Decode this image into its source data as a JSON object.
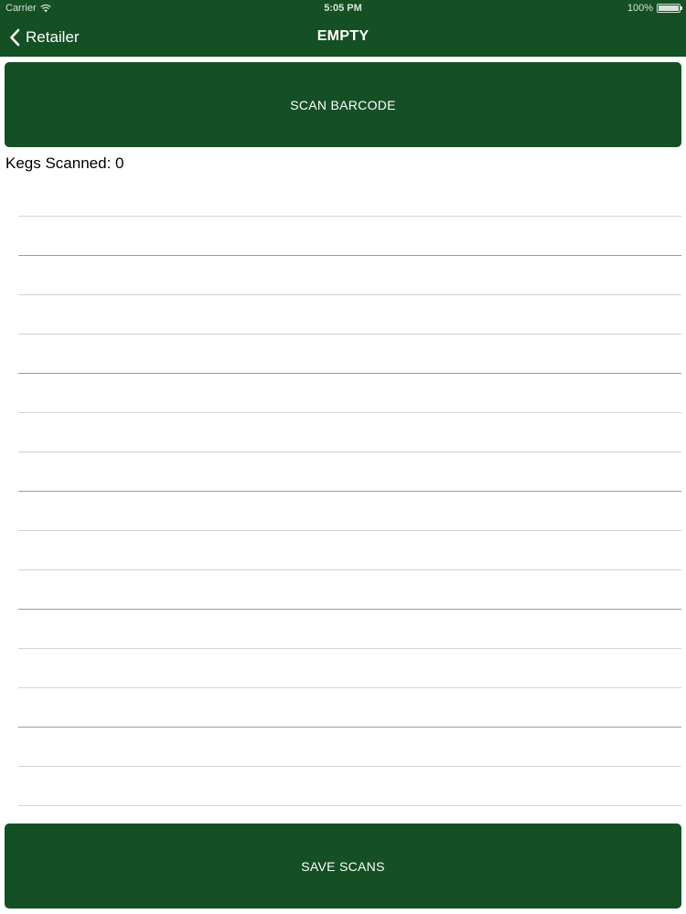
{
  "status_bar": {
    "carrier": "Carrier",
    "time": "5:05 PM",
    "battery": "100%",
    "wifi_icon": "wifi-icon",
    "battery_icon": "battery-icon"
  },
  "nav": {
    "back_label": "Retailer",
    "back_icon": "chevron-left-icon",
    "title": "EMPTY"
  },
  "scan_button_label": "SCAN BARCODE",
  "kegs_scanned_label": "Kegs Scanned: 0",
  "scan_list": {
    "rows": [
      "",
      "",
      "",
      "",
      "",
      "",
      "",
      "",
      "",
      "",
      "",
      "",
      "",
      "",
      "",
      ""
    ]
  },
  "save_button_label": "SAVE SCANS",
  "colors": {
    "accent": "#154f24",
    "text_on_accent": "#ffffff",
    "separator": "#d3d3d3"
  }
}
